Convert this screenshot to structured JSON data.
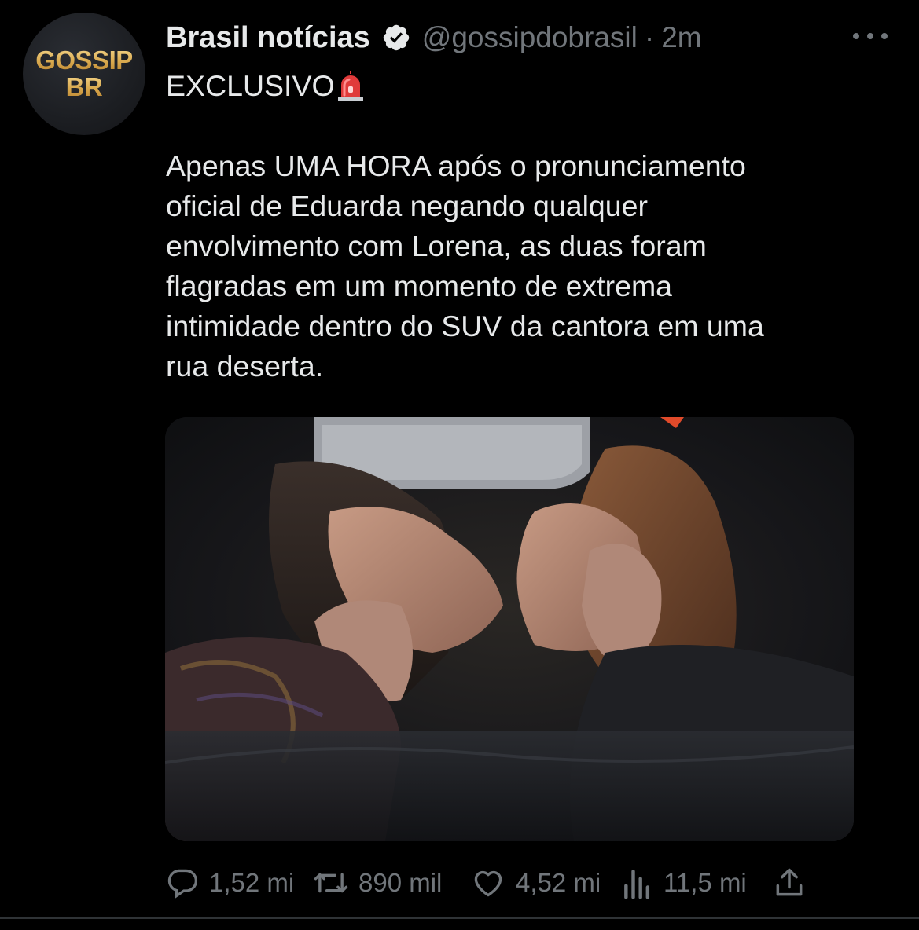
{
  "colors": {
    "background": "#000000",
    "text_primary": "#e7e9ea",
    "text_secondary": "#71767b",
    "verified_badge": "#e7e9ea",
    "avatar_gold": "#d9a94e"
  },
  "author": {
    "avatar_line1": "GOSSIP",
    "avatar_line2": "BR",
    "display_name": "Brasil notícias",
    "verified": true,
    "handle": "@gossipdobrasil",
    "separator": "·",
    "timestamp": "2m"
  },
  "tweet": {
    "headline": "EXCLUSIVO",
    "headline_emoji": "siren-icon",
    "body": "Apenas UMA HORA após o pronunciamento\noficial de Eduarda negando qualquer\nenvolvimento com Lorena, as duas foram\nflagradas em um momento de extrema\nintimidade dentro do SUV da cantora em uma\nrua deserta."
  },
  "actions": {
    "reply_count": "1,52 mi",
    "retweet_count": "890 mil",
    "like_count": "4,52 mi",
    "views_count": "11,5 mi"
  },
  "icons": {
    "reply": "reply-icon",
    "retweet": "retweet-icon",
    "like": "heart-icon",
    "views": "views-icon",
    "share": "share-icon",
    "more": "more-icon",
    "verified": "verified-icon"
  }
}
